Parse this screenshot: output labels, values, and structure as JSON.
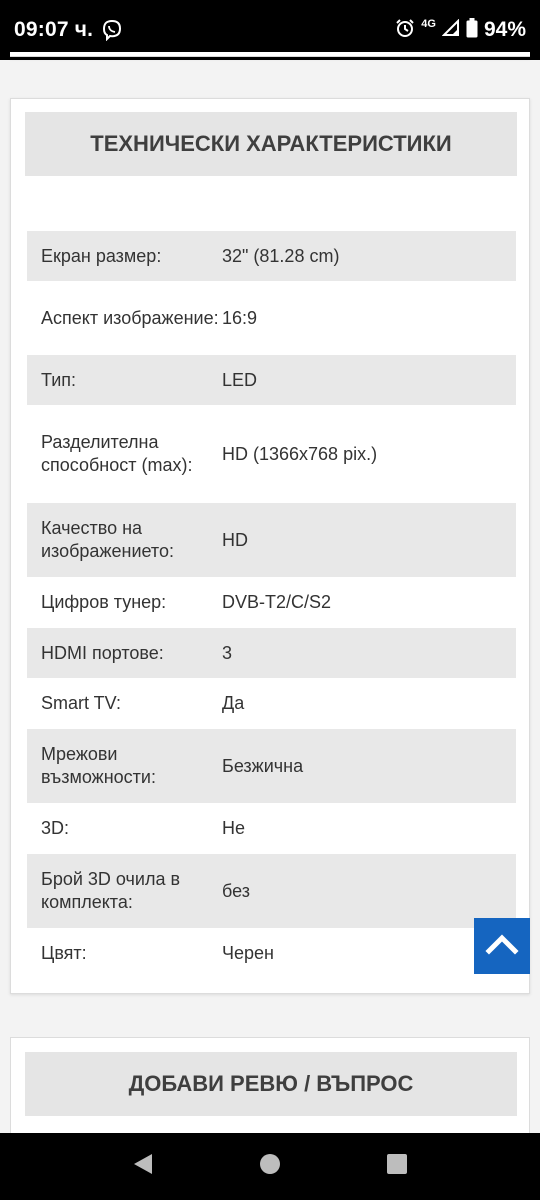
{
  "status_bar": {
    "time": "09:07 ч.",
    "network": "4G",
    "battery": "94%"
  },
  "specs": {
    "title": "ТЕХНИЧЕСКИ ХАРАКТЕРИСТИКИ",
    "rows": [
      {
        "label": "Екран размер:",
        "value": "32\" (81.28 cm)"
      },
      {
        "label": "Аспект изображение:",
        "value": "16:9"
      },
      {
        "label": "Тип:",
        "value": "LED"
      },
      {
        "label": "Разделителна способност (max):",
        "value": "HD (1366x768 pix.)"
      },
      {
        "label": "Качество на изображението:",
        "value": "HD"
      },
      {
        "label": "Цифров тунер:",
        "value": "DVB-T2/C/S2"
      },
      {
        "label": "HDMI портове:",
        "value": "3"
      },
      {
        "label": "Smart TV:",
        "value": "Да"
      },
      {
        "label": "Мрежови възможности:",
        "value": "Безжична"
      },
      {
        "label": "3D:",
        "value": "Не"
      },
      {
        "label": "Брой 3D очила в комплекта:",
        "value": "без"
      },
      {
        "label": "Цвят:",
        "value": "Черен"
      }
    ]
  },
  "review": {
    "title": "ДОБАВИ РЕВЮ / ВЪПРОС"
  },
  "icons": {
    "viber": "viber-icon",
    "alarm": "alarm-icon",
    "signal": "signal-icon",
    "battery": "battery-icon",
    "scroll_top": "chevron-up-icon",
    "nav_back": "back-triangle-icon",
    "nav_home": "home-circle-icon",
    "nav_recents": "recents-square-icon"
  },
  "colors": {
    "accent": "#1565c0",
    "header_bg": "#e5e5e5",
    "row_shade": "#e8e8e8"
  }
}
